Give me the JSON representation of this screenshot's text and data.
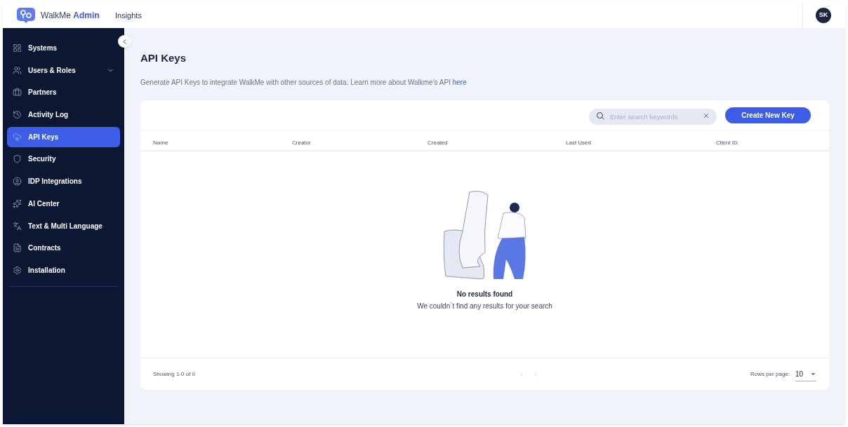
{
  "header": {
    "brand": "WalkMe",
    "brand_suffix": "Admin",
    "nav": [
      "Insights"
    ],
    "avatar": "SK"
  },
  "sidebar": {
    "items": [
      {
        "label": "Systems",
        "kind": "link",
        "selected": false
      },
      {
        "label": "Users & Roles",
        "kind": "group",
        "selected": false
      },
      {
        "label": "Partners",
        "kind": "link",
        "selected": false
      },
      {
        "label": "Activity Log",
        "kind": "link",
        "selected": false
      },
      {
        "label": "API Keys",
        "kind": "link",
        "selected": true
      },
      {
        "label": "Security",
        "kind": "link",
        "selected": false
      },
      {
        "label": "IDP Integrations",
        "kind": "link",
        "selected": false
      },
      {
        "label": "AI Center",
        "kind": "link",
        "selected": false
      },
      {
        "label": "Text & Multi Language",
        "kind": "link",
        "selected": false
      },
      {
        "label": "Contracts",
        "kind": "link",
        "selected": false
      },
      {
        "label": "Installation",
        "kind": "link",
        "selected": false
      }
    ]
  },
  "page": {
    "title": "API Keys",
    "description": "Generate API Keys to integrate WalkMe with other sources of data. Learn more about Walkme's API",
    "link": "here"
  },
  "search": {
    "placeholder": "Enter search keywords"
  },
  "create_button": "Create New Key",
  "table": {
    "columns": [
      "Name",
      "Creator",
      "Created",
      "Last Used",
      "Client ID"
    ]
  },
  "empty": {
    "title": "No results found",
    "message": "We couldn`t find any results for your search"
  },
  "footer": {
    "showing": "Showing 1-0 of 0",
    "rows_label": "Rows per page:",
    "rows_value": "10"
  }
}
